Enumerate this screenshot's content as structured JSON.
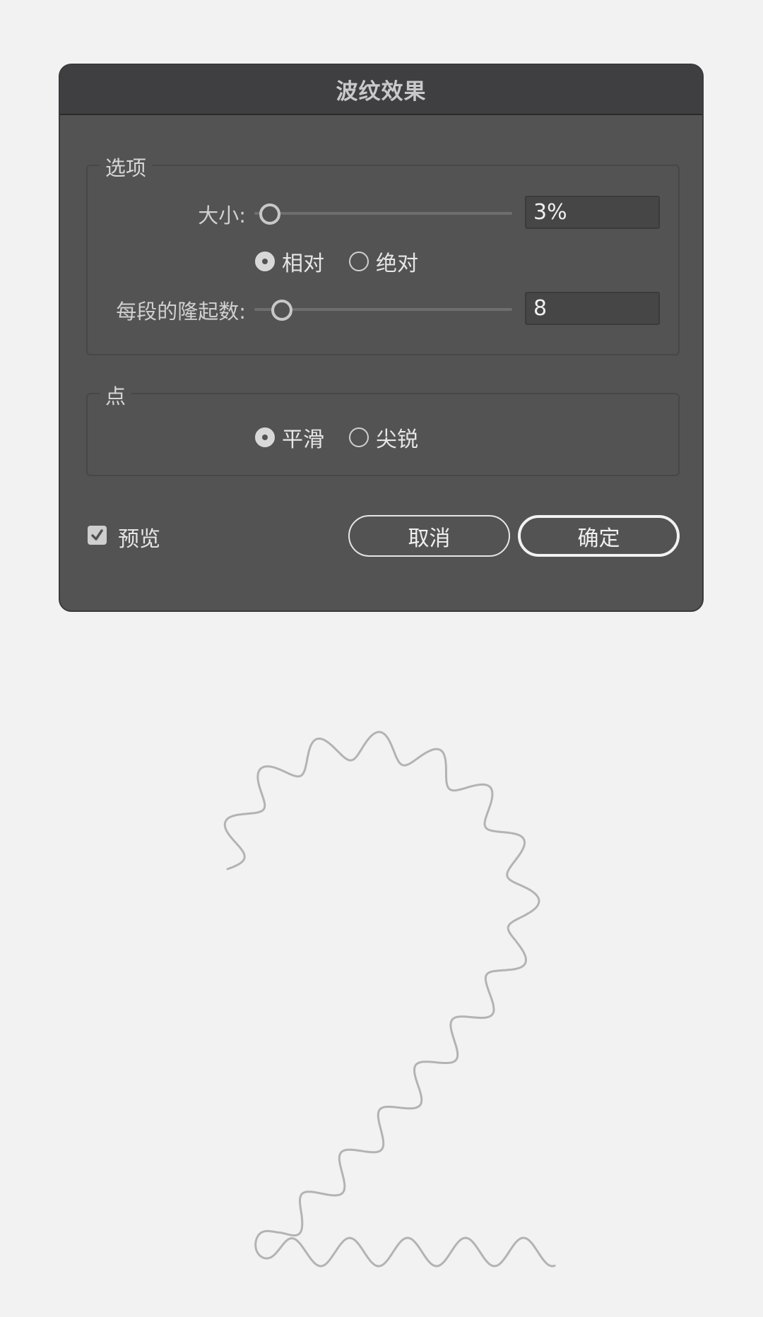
{
  "dialog": {
    "title": "波纹效果",
    "options_group": {
      "label": "选项",
      "size_label": "大小:",
      "size_value": "3%",
      "size_slider_fraction": 0.03,
      "mode_options": [
        {
          "label": "相对",
          "checked": true
        },
        {
          "label": "绝对",
          "checked": false
        }
      ],
      "ridges_label": "每段的隆起数:",
      "ridges_value": "8",
      "ridges_slider_fraction": 0.08
    },
    "points_group": {
      "label": "点",
      "options": [
        {
          "label": "平滑",
          "checked": true
        },
        {
          "label": "尖锐",
          "checked": false
        }
      ]
    },
    "preview": {
      "label": "预览",
      "checked": true
    },
    "buttons": {
      "cancel": "取消",
      "ok": "确定"
    }
  },
  "colors": {
    "dialog_bg": "#535353",
    "titlebar_bg": "#3f3f42",
    "canvas_bg": "#f2f2f2",
    "wave_stroke": "#b3b3b3"
  },
  "icons": {
    "preview_check": "checkmark-icon",
    "slider_thumb": "circle-handle-icon"
  }
}
